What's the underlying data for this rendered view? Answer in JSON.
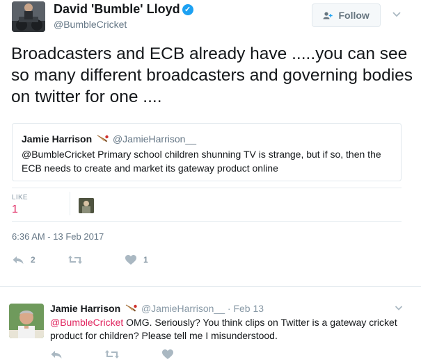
{
  "author": {
    "display_name": "David 'Bumble' Lloyd",
    "username": "@BumbleCricket",
    "verified": true,
    "verified_glyph": "✓"
  },
  "follow_button": {
    "label": "Follow",
    "icon": "add-user-icon"
  },
  "tweet": {
    "text": "Broadcasters and ECB already have .....you can see so many different broadcasters and governing bodies on twitter for one ....",
    "timestamp": "6:36 AM - 13 Feb 2017"
  },
  "quoted_tweet": {
    "name": "Jamie Harrison",
    "handle": "@JamieHarrison__",
    "text": "@BumbleCricket Primary school children shunning TV is strange, but if so, then the ECB needs to create and market its gateway product online"
  },
  "stats": {
    "like_label": "LIKE",
    "like_count": "1"
  },
  "actions": {
    "reply_count": "2",
    "retweet_count": "",
    "like_count": "1"
  },
  "reply": {
    "name": "Jamie Harrison",
    "handle": "@JamieHarrison__",
    "separator": "·",
    "time": "Feb 13",
    "mention": "@BumbleCricket",
    "text": " OMG. Seriously? You think clips on Twitter is a gateway cricket product for children? Please tell me I misunderstood."
  },
  "colors": {
    "accent_blue": "#1da1f2",
    "like_red": "#e0245e",
    "muted": "#657786",
    "icon_grey": "#aab8c2"
  }
}
